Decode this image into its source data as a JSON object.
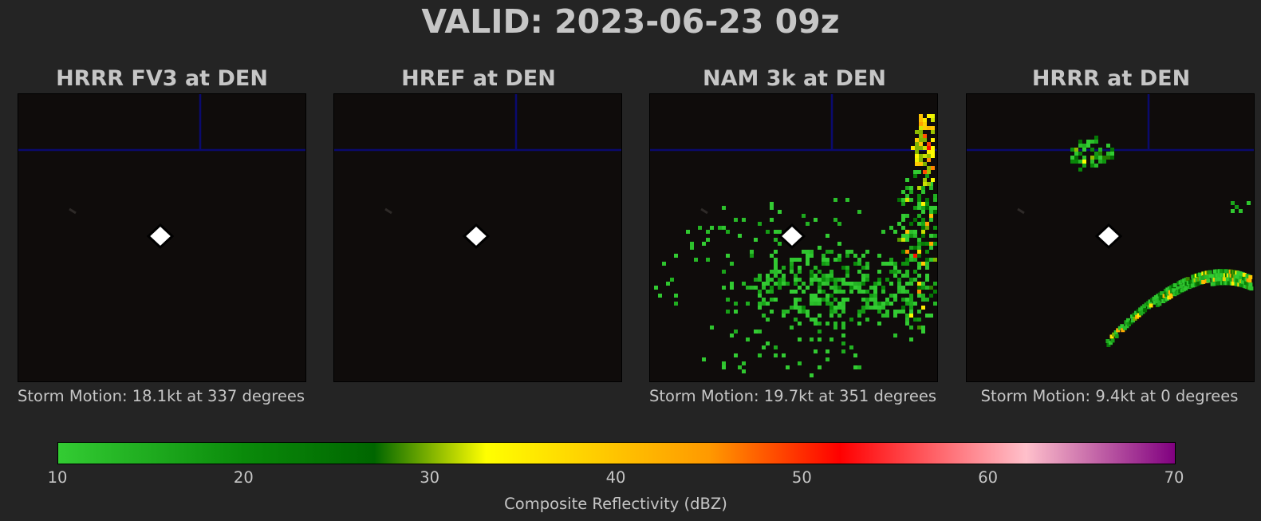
{
  "title": "VALID: 2023-06-23 09z",
  "colors": {
    "background": "#242424",
    "panel_background": "#0f0c0b",
    "grid_line": "#0a0a6e",
    "marker": "#ffffff",
    "text": "#c6c6c6"
  },
  "chart_data": [
    {
      "type": "heatmap",
      "title": "HRRR FV3 at DEN",
      "annotation": "Storm Motion: 18.1kt at 337 degrees",
      "marker": "white-diamond",
      "echo_regions": []
    },
    {
      "type": "heatmap",
      "title": "HREF at DEN",
      "annotation": "",
      "marker": "white-diamond",
      "echo_regions": []
    },
    {
      "type": "heatmap",
      "title": "NAM 3k at DEN",
      "annotation": "Storm Motion: 19.7kt at 351 degrees",
      "marker": "white-diamond",
      "echo_regions": [
        {
          "area": "south-central cluster",
          "dbz_range": [
            10,
            25
          ],
          "density": 0.45
        },
        {
          "area": "east edge band",
          "dbz_range": [
            10,
            55
          ],
          "density": 0.5
        },
        {
          "area": "northeast core",
          "dbz_range": [
            30,
            55
          ],
          "density": 0.8
        },
        {
          "area": "scattered cells",
          "dbz_range": [
            10,
            20
          ],
          "density": 0.08
        }
      ]
    },
    {
      "type": "heatmap",
      "title": "HRRR at DEN",
      "annotation": "Storm Motion: 9.4kt at 0 degrees",
      "marker": "white-diamond",
      "echo_regions": [
        {
          "area": "north cluster",
          "dbz_range": [
            10,
            40
          ],
          "density": 0.55
        },
        {
          "area": "southeast arc band",
          "dbz_range": [
            10,
            45
          ],
          "density": 0.85
        },
        {
          "area": "east isolated cell",
          "dbz_range": [
            10,
            20
          ],
          "density": 0.6
        }
      ]
    }
  ],
  "colorbar": {
    "label": "Composite Reflectivity (dBZ)",
    "range": [
      10,
      70
    ],
    "ticks": [
      "10",
      "20",
      "30",
      "40",
      "50",
      "60",
      "70"
    ],
    "stops": [
      {
        "value": 10,
        "color": "#33cc33"
      },
      {
        "value": 20,
        "color": "#0a8a0a"
      },
      {
        "value": 27,
        "color": "#006600"
      },
      {
        "value": 33,
        "color": "#ffff00"
      },
      {
        "value": 45,
        "color": "#ff9900"
      },
      {
        "value": 52,
        "color": "#ff0000"
      },
      {
        "value": 62,
        "color": "#ffc0cb"
      },
      {
        "value": 70,
        "color": "#800080"
      }
    ]
  }
}
